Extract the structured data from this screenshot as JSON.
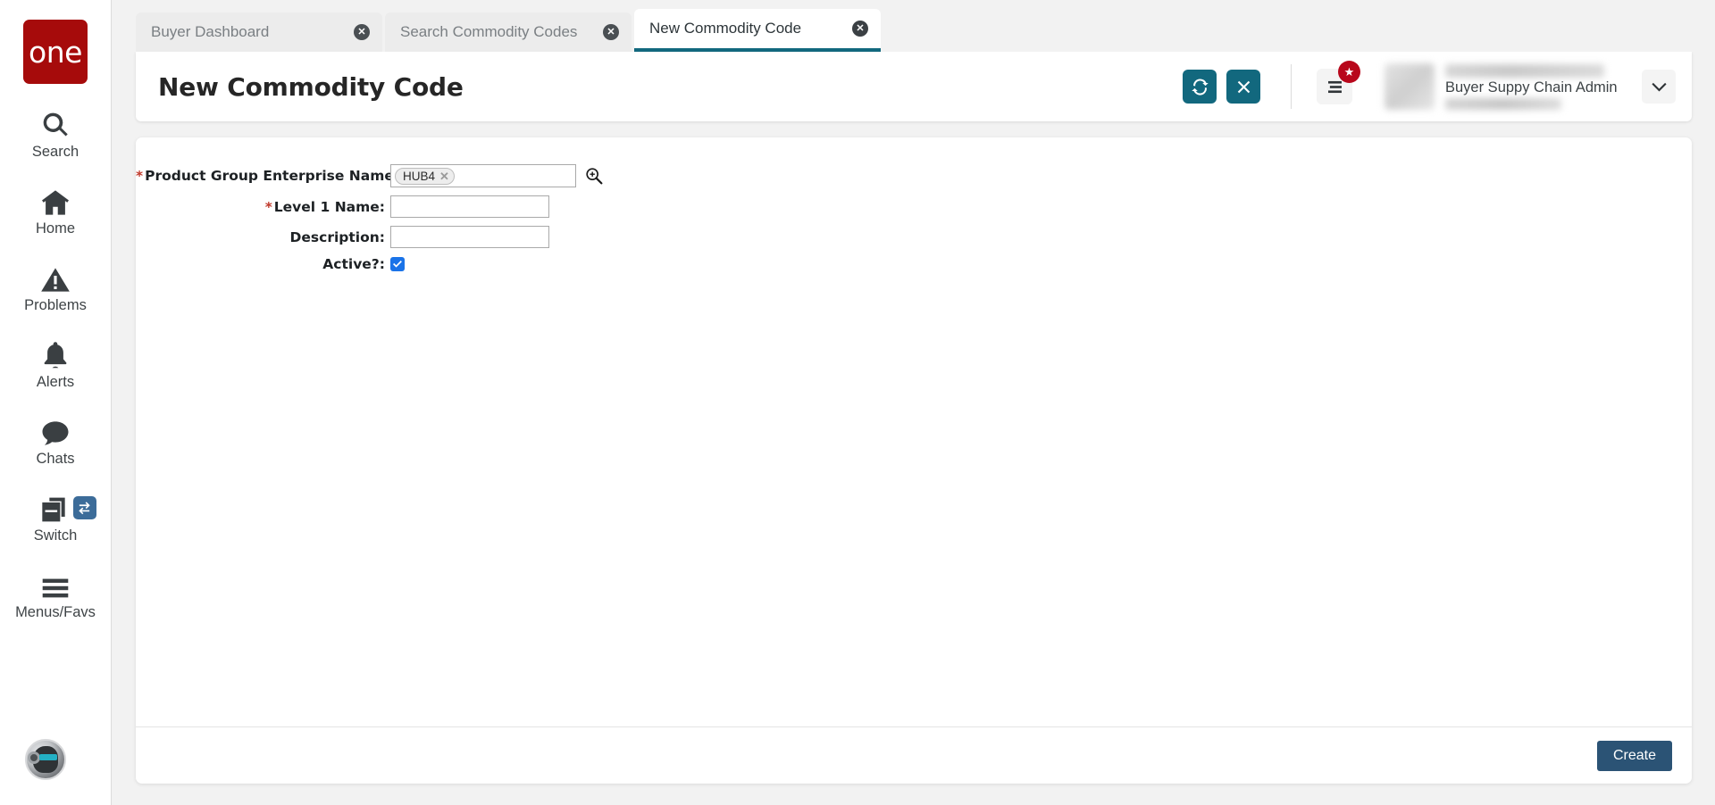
{
  "brand": {
    "logo_text": "one",
    "logo_color": "#a60b0b"
  },
  "sidebar": {
    "items": [
      {
        "label": "Search",
        "icon": "search-icon"
      },
      {
        "label": "Home",
        "icon": "home-icon"
      },
      {
        "label": "Problems",
        "icon": "warning-triangle-icon"
      },
      {
        "label": "Alerts",
        "icon": "bell-icon"
      },
      {
        "label": "Chats",
        "icon": "chat-bubble-icon"
      },
      {
        "label": "Switch",
        "icon": "switch-windows-icon"
      },
      {
        "label": "Menus/Favs",
        "icon": "hamburger-icon"
      }
    ],
    "assistant_avatar": "ai-assistant-avatar"
  },
  "tabs": [
    {
      "label": "Buyer Dashboard",
      "active": false,
      "close": "✕"
    },
    {
      "label": "Search Commodity Codes",
      "active": false,
      "close": "✕"
    },
    {
      "label": "New Commodity Code",
      "active": true,
      "close": "✕"
    }
  ],
  "header": {
    "title": "New Commodity Code",
    "refresh_button": "refresh-icon",
    "close_button": "close-icon",
    "menu_favs_button": "menu-icon",
    "star_badge": "★",
    "accent_color": "#12687e"
  },
  "user": {
    "role": "Buyer Suppy Chain Admin",
    "caret": "❯"
  },
  "form": {
    "fields": [
      {
        "label": "Product Group Enterprise Name:",
        "required": true,
        "type": "chip",
        "chip_value": "HUB4",
        "chip_remove": "✕"
      },
      {
        "label": "Level 1 Name:",
        "required": true,
        "type": "text",
        "value": "",
        "placeholder": ""
      },
      {
        "label": "Description:",
        "required": false,
        "type": "text",
        "value": "",
        "placeholder": ""
      },
      {
        "label": "Active?:",
        "required": false,
        "type": "checkbox",
        "checked": true
      }
    ],
    "submit_label": "Create",
    "submit_color": "#2b5375"
  }
}
